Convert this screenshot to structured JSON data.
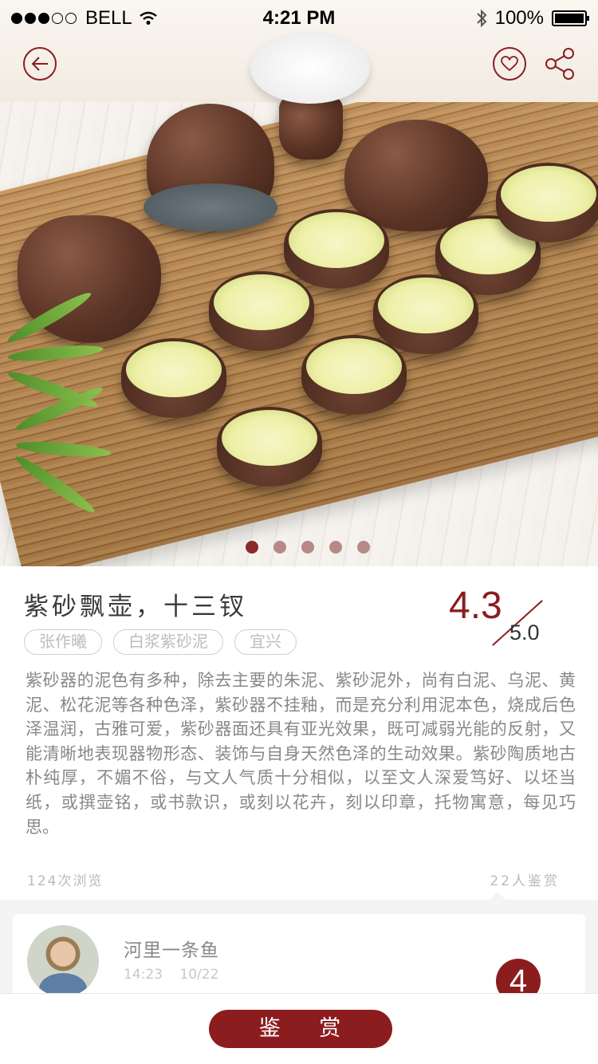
{
  "status_bar": {
    "carrier": "BELL",
    "time": "4:21 PM",
    "battery": "100%"
  },
  "hero": {
    "image_alt": "紫砂茶具",
    "page_count": 5,
    "active_page": 1
  },
  "product": {
    "title": "紫砂飘壶，十三钗",
    "tags": [
      "张作曦",
      "白浆紫砂泥",
      "宜兴"
    ],
    "rating": "4.3",
    "rating_max": "5.0",
    "description": "紫砂器的泥色有多种，除去主要的朱泥、紫砂泥外，尚有白泥、乌泥、黄泥、松花泥等各种色泽，紫砂器不挂釉，而是充分利用泥本色，烧成后色泽温润，古雅可爱，紫砂器面还具有亚光效果，既可减弱光能的反射，又能清晰地表现器物形态、装饰与自身天然色泽的生动效果。紫砂陶质地古朴纯厚，不媚不俗，与文人气质十分相似，以至文人深爱笃好、以坯当纸，或撰壶铭，或书款识，或刻以花卉，刻以印章，托物寓意，每见巧思。",
    "views": "124次浏览",
    "appraisers": "22人鉴赏"
  },
  "comment": {
    "user_name": "河里一条鱼",
    "time": "14:23",
    "date": "10/22",
    "score": "4"
  },
  "bottom": {
    "action_label": "鉴 赏"
  },
  "colors": {
    "accent": "#8b1d1f",
    "pager_inactive": "#b58a86"
  }
}
